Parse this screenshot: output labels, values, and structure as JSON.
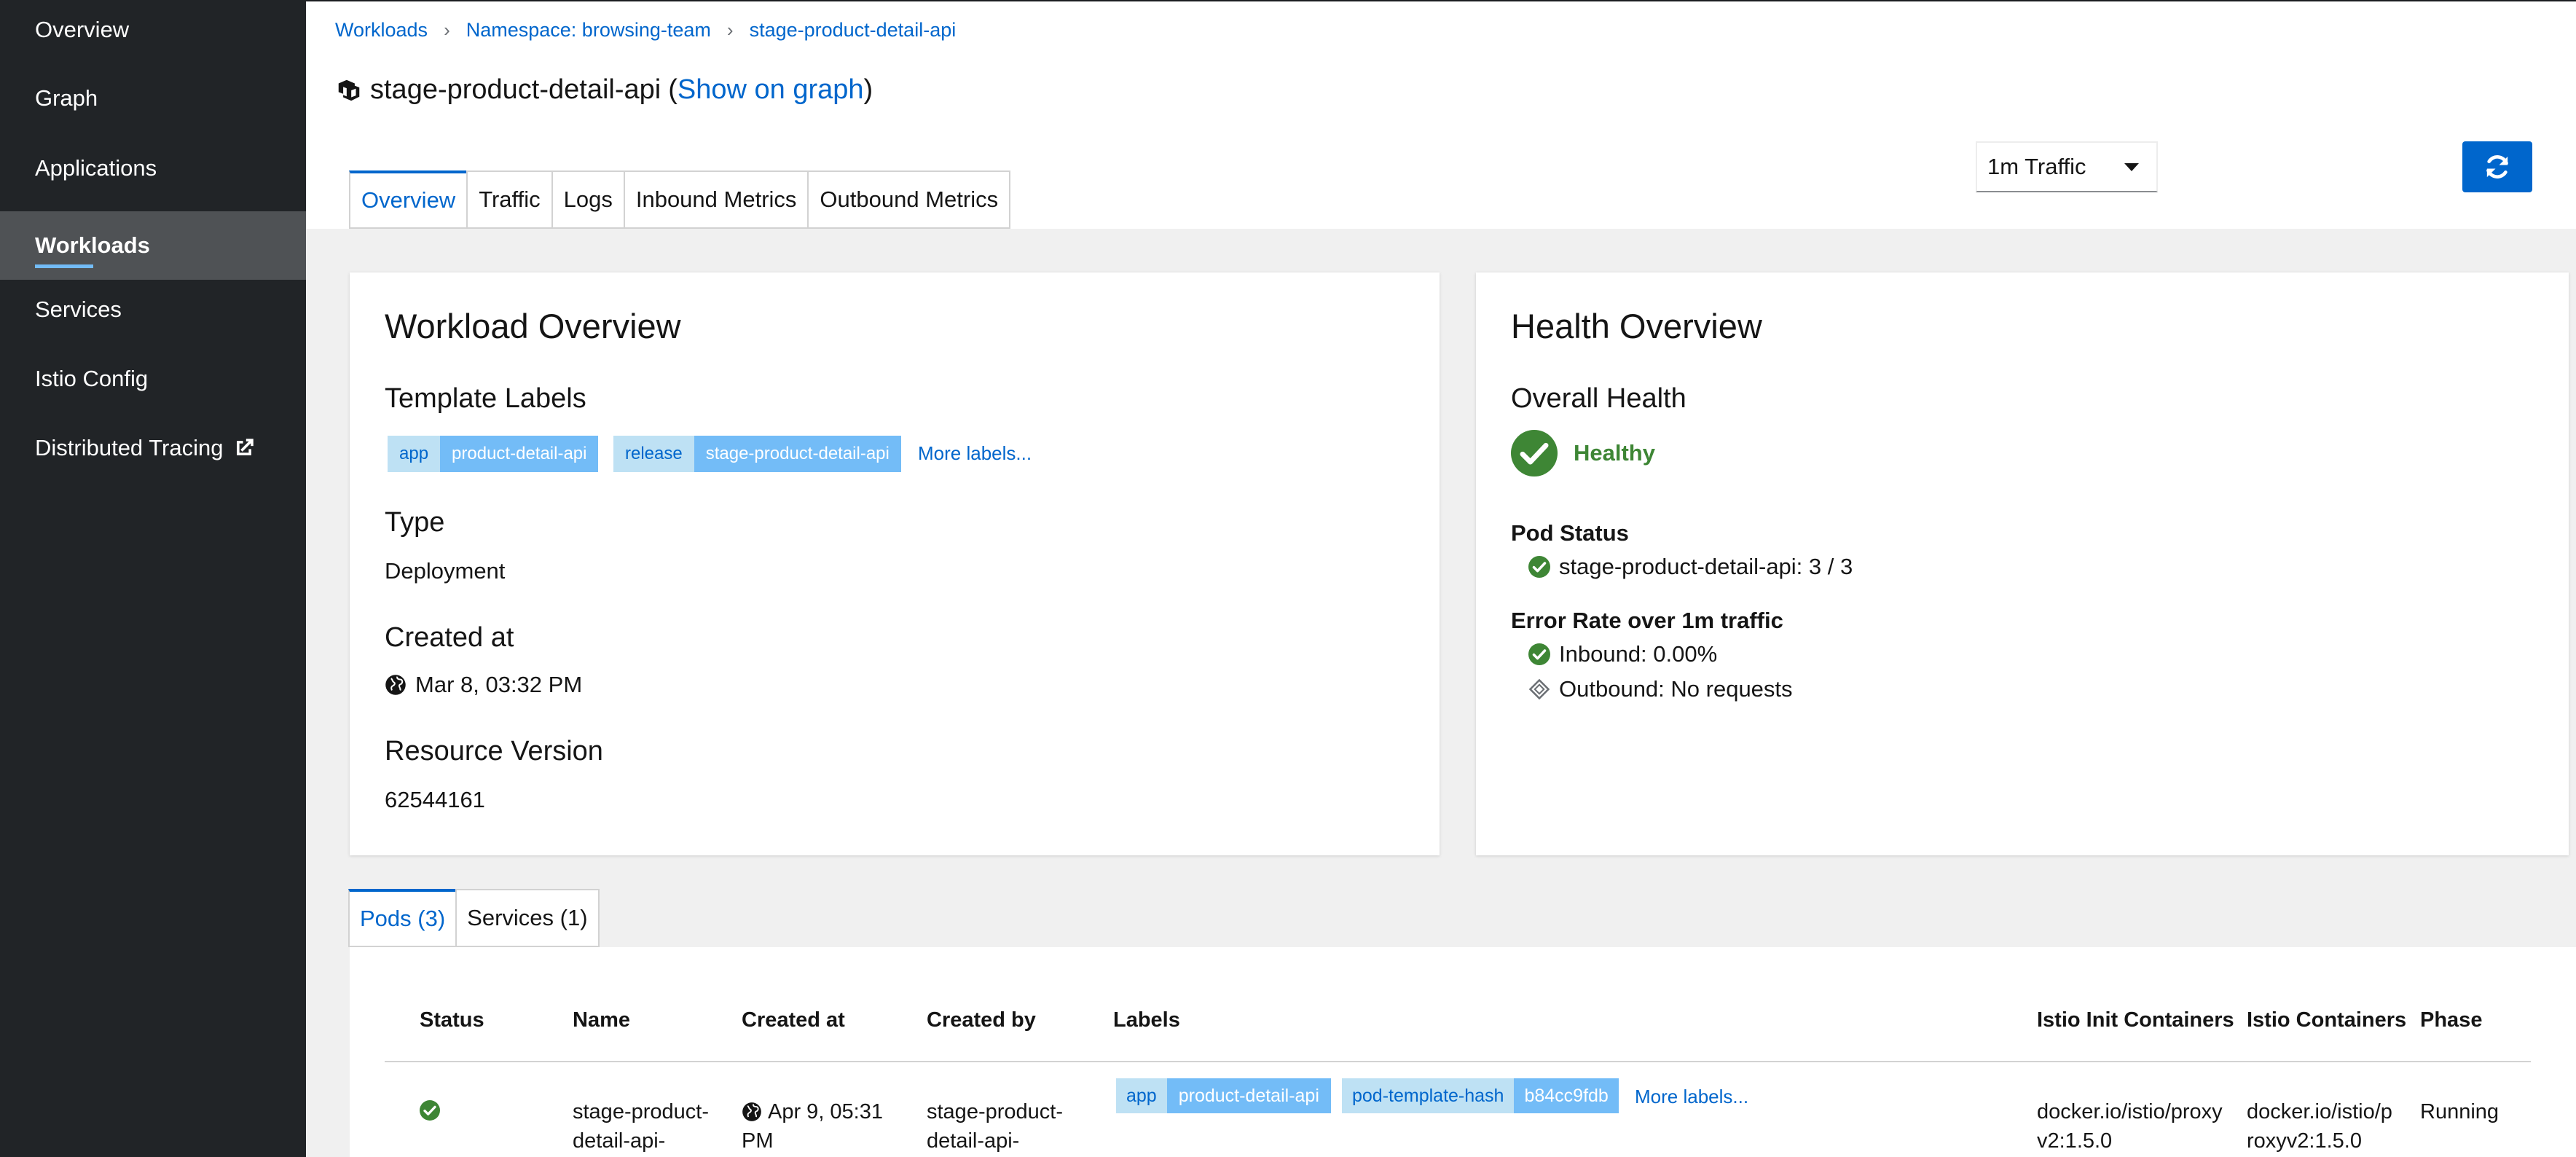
{
  "sidebar": {
    "items": [
      {
        "label": "Overview"
      },
      {
        "label": "Graph"
      },
      {
        "label": "Applications"
      },
      {
        "label": "Workloads"
      },
      {
        "label": "Services"
      },
      {
        "label": "Istio Config"
      },
      {
        "label": "Distributed Tracing"
      }
    ],
    "active_index": 3
  },
  "breadcrumb": {
    "items": [
      "Workloads",
      "Namespace: browsing-team",
      "stage-product-detail-api"
    ]
  },
  "title": {
    "name": "stage-product-detail-api",
    "open_paren": "(",
    "link": "Show on graph",
    "close_paren": ")"
  },
  "tabs": [
    "Overview",
    "Traffic",
    "Logs",
    "Inbound Metrics",
    "Outbound Metrics"
  ],
  "traffic_select": {
    "value": "1m Traffic"
  },
  "workload_overview": {
    "heading": "Workload Overview",
    "template_labels_heading": "Template Labels",
    "labels": [
      {
        "key": "app",
        "value": "product-detail-api"
      },
      {
        "key": "release",
        "value": "stage-product-detail-api"
      }
    ],
    "more_labels": "More labels...",
    "type_heading": "Type",
    "type_value": "Deployment",
    "created_heading": "Created at",
    "created_value": "Mar 8, 03:32 PM",
    "resource_heading": "Resource Version",
    "resource_value": "62544161"
  },
  "health_overview": {
    "heading": "Health Overview",
    "overall_heading": "Overall Health",
    "overall_status": "Healthy",
    "pod_status_label": "Pod Status",
    "pod_status_value": "stage-product-detail-api: 3 / 3",
    "error_rate_label": "Error Rate over 1m traffic",
    "inbound": "Inbound: 0.00%",
    "outbound": "Outbound: No requests"
  },
  "bottom_tabs": [
    "Pods (3)",
    "Services (1)"
  ],
  "pods_table": {
    "columns": [
      "Status",
      "Name",
      "Created at",
      "Created by",
      "Labels",
      "Istio Init Containers",
      "Istio Containers",
      "Phase"
    ],
    "rows": [
      {
        "name_l1": "stage-product-",
        "name_l2": "detail-api-",
        "created_l1": "Apr 9, 05:31",
        "created_l2": "PM",
        "created_by_l1": "stage-product-",
        "created_by_l2": "detail-api-",
        "labels": [
          {
            "key": "app",
            "value": "product-detail-api"
          },
          {
            "key": "pod-template-hash",
            "value": "b84cc9fdb"
          }
        ],
        "more_labels": "More labels...",
        "init_l1": "docker.io/istio/proxy",
        "init_l2": "v2:1.5.0",
        "containers_l1": "docker.io/istio/p",
        "containers_l2": "roxyv2:1.5.0",
        "phase": "Running"
      }
    ]
  },
  "colors": {
    "sidebar_bg": "#212427",
    "sidebar_active_bg": "#4f5255",
    "link_blue": "#0066cc",
    "healthy_green": "#3e8635",
    "chip_key_bg": "#bee1f4",
    "chip_value_bg": "#73bcf7"
  }
}
